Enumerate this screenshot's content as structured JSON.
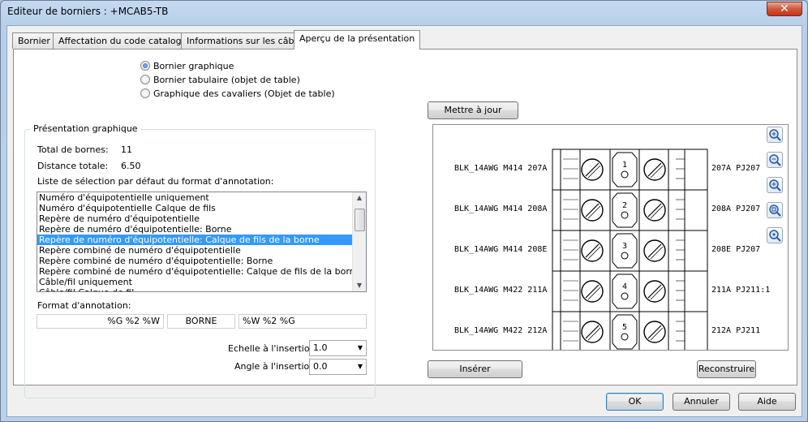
{
  "window": {
    "title": "Editeur de borniers : +MCAB5-TB",
    "close": "✕"
  },
  "tabs": [
    "Bornier",
    "Affectation du code catalogue",
    "Informations sur les câbles",
    "Aperçu de la présentation"
  ],
  "options": {
    "radios": [
      "Bornier graphique",
      "Bornier tabulaire (objet de table)",
      "Graphique des cavaliers (Objet de table)"
    ],
    "selected": 0
  },
  "group": {
    "title": "Présentation graphique",
    "total_label": "Total de bornes:",
    "total_value": "11",
    "distance_label": "Distance totale:",
    "distance_value": "6.50",
    "list_label": "Liste de sélection par défaut du format d'annotation:",
    "list_items": [
      "Numéro d'équipotentielle uniquement",
      "Numéro d'équipotentielle Calque de fils",
      "Repère de numéro d'équipotentielle",
      "Repère de numéro d'équipotentielle: Borne",
      "Repère de numéro d'équipotentielle: Calque de fils de la borne",
      "Repère combiné de numéro d'équipotentielle",
      "Repère combiné de numéro d'équipotentielle: Borne",
      "Repère combiné de numéro d'équipotentielle: Calque de fils de la borne",
      "Câble/fil uniquement",
      "Câble/fil Calque de fil"
    ],
    "list_selected": 4,
    "format_label": "Format d'annotation:",
    "format_left": "%G %2 %W",
    "format_mid": "BORNE",
    "format_right": "%W %2 %G",
    "scale_label": "Echelle à l'insertion:",
    "scale_value": "1.0",
    "angle_label": "Angle à l'insertion:",
    "angle_value": "0.0"
  },
  "preview": {
    "update_button": "Mettre à jour",
    "insert_button": "Insérer",
    "rebuild_button": "Reconstruire",
    "rows": [
      {
        "num": "1",
        "left": "BLK_14AWG  M414  207A",
        "right": "207A  PJ207"
      },
      {
        "num": "2",
        "left": "BLK_14AWG  M414  208A",
        "right": "208A  PJ207"
      },
      {
        "num": "3",
        "left": "BLK_14AWG  M414  208E",
        "right": "208E  PJ207"
      },
      {
        "num": "4",
        "left": "BLK_14AWG  M422  211A",
        "right": "211A  PJ211:1"
      },
      {
        "num": "5",
        "left": "BLK_14AWG  M422  212A",
        "right": "212A  PJ211"
      }
    ],
    "zoom_icons": [
      "zoom-in-icon",
      "zoom-out-icon",
      "zoom-window-icon",
      "zoom-extents-icon",
      "pan-icon"
    ]
  },
  "footer": {
    "ok": "OK",
    "cancel": "Annuler",
    "help": "Aide"
  },
  "colors": {
    "selection": "#3399ff",
    "accent": "#3c7fb1"
  }
}
